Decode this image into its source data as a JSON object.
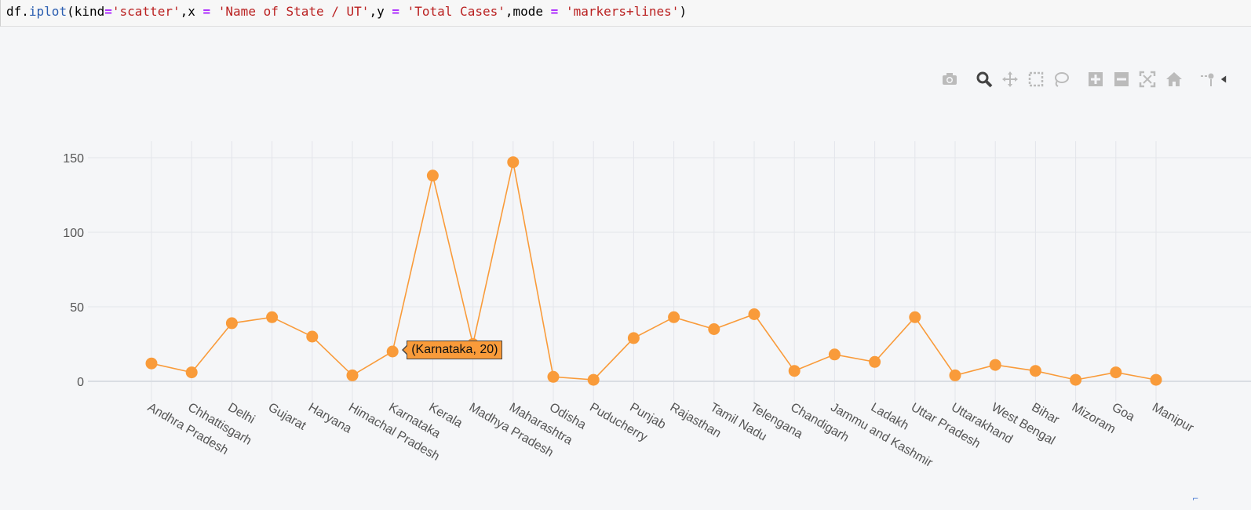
{
  "code_cell": {
    "prefix": "df.",
    "method": "iplot",
    "t1": "(kind",
    "eq": "=",
    "s_kind": "'scatter'",
    "t2": ",x ",
    "s_x": "'Name of State / UT'",
    "t3": ",y ",
    "s_y": "'Total Cases'",
    "t4": ",mode ",
    "s_mode": "'markers+lines'",
    "t5": ")"
  },
  "modebar": [
    {
      "name": "camera-icon"
    },
    {
      "name": "zoom-icon"
    },
    {
      "name": "pan-icon"
    },
    {
      "name": "box-select-icon"
    },
    {
      "name": "lasso-select-icon"
    },
    {
      "name": "zoom-in-icon"
    },
    {
      "name": "zoom-out-icon"
    },
    {
      "name": "autoscale-icon"
    },
    {
      "name": "reset-axes-icon"
    },
    {
      "name": "spike-lines-icon"
    },
    {
      "name": "collapse-arrow-icon"
    }
  ],
  "tooltip": {
    "text": "(Karnataka, 20)",
    "index": 6
  },
  "corner_mark": "⌐",
  "chart_data": {
    "type": "line",
    "mode": "markers+lines",
    "color": "#f99b3a",
    "categories": [
      "Andhra Pradesh",
      "Chhattisgarh",
      "Delhi",
      "Gujarat",
      "Haryana",
      "Himachal Pradesh",
      "Karnataka",
      "Kerala",
      "Madhya Pradesh",
      "Maharashtra",
      "Odisha",
      "Puducherry",
      "Punjab",
      "Rajasthan",
      "Tamil Nadu",
      "Telengana",
      "Chandigarh",
      "Jammu and Kashmir",
      "Ladakh",
      "Uttar Pradesh",
      "Uttarakhand",
      "West Bengal",
      "Bihar",
      "Mizoram",
      "Goa",
      "Manipur"
    ],
    "values": [
      12,
      6,
      39,
      43,
      30,
      4,
      20,
      138,
      25,
      147,
      3,
      1,
      29,
      43,
      35,
      45,
      7,
      18,
      13,
      43,
      4,
      11,
      7,
      1,
      6,
      1
    ],
    "ylim": [
      -4,
      160
    ],
    "yticks": [
      0,
      50,
      100,
      150
    ],
    "grid": true,
    "legend": false
  }
}
